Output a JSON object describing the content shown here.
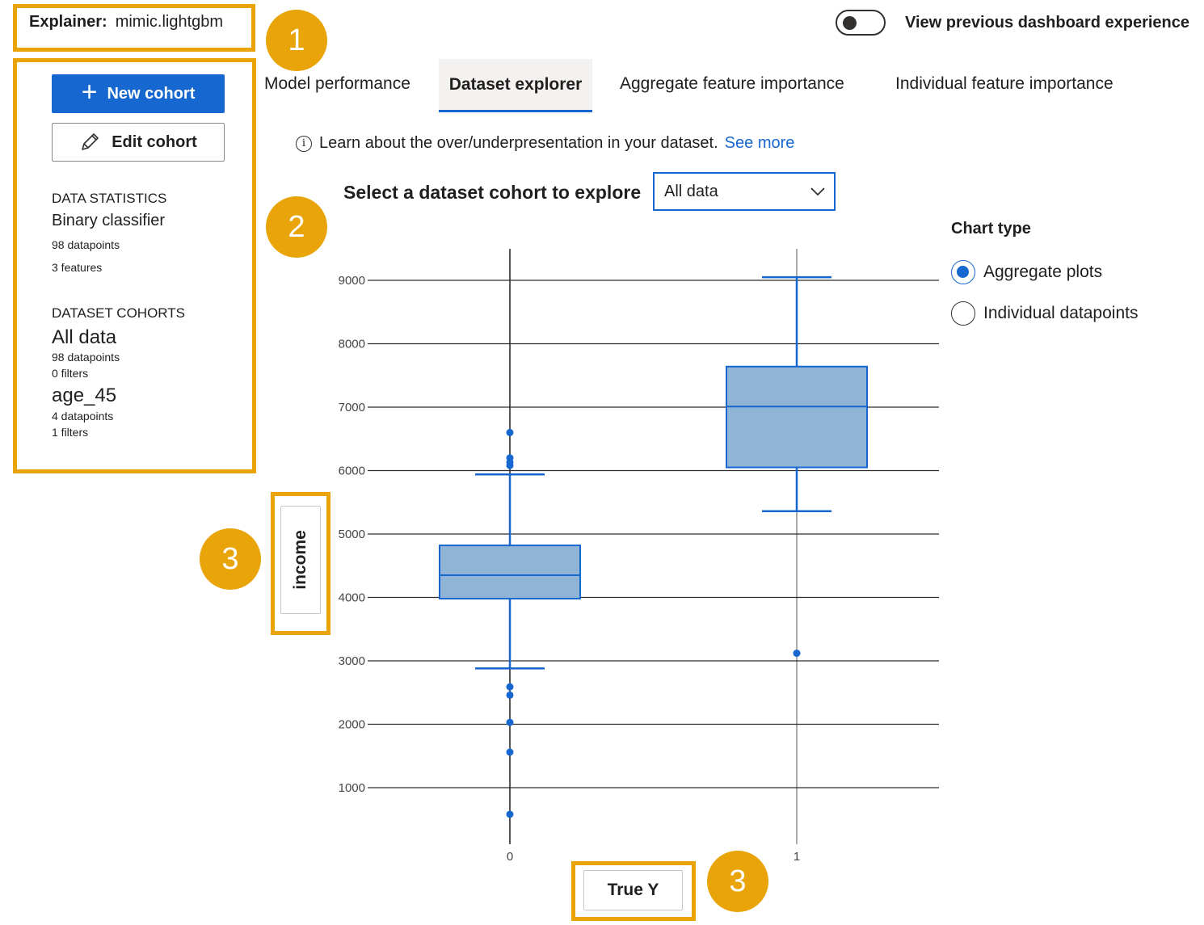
{
  "explainer": {
    "label": "Explainer:",
    "value": "mimic.lightgbm"
  },
  "toggle": {
    "label": "View previous dashboard experience",
    "on": false
  },
  "callouts": [
    "1",
    "2",
    "3",
    "3"
  ],
  "left_panel": {
    "new_cohort": "New cohort",
    "edit_cohort": "Edit cohort",
    "data_statistics": {
      "heading": "DATA STATISTICS",
      "type": "Binary classifier",
      "datapoints": "98 datapoints",
      "features": "3 features"
    },
    "dataset_cohorts": {
      "heading": "DATASET COHORTS",
      "items": [
        {
          "name": "All data",
          "datapoints": "98 datapoints",
          "filters": "0 filters"
        },
        {
          "name": "age_45",
          "datapoints": "4 datapoints",
          "filters": "1 filters"
        }
      ]
    }
  },
  "tabs": [
    {
      "label": "Model performance",
      "active": false
    },
    {
      "label": "Dataset explorer",
      "active": true
    },
    {
      "label": "Aggregate feature importance",
      "active": false
    },
    {
      "label": "Individual feature importance",
      "active": false
    }
  ],
  "info": {
    "text": "Learn about the over/underpresentation in your dataset.",
    "link": "See more",
    "icon": "info-icon"
  },
  "cohort_select": {
    "label": "Select a dataset cohort to explore",
    "value": "All data",
    "icon": "chevron-down-icon"
  },
  "chart_type": {
    "title": "Chart type",
    "options": [
      {
        "label": "Aggregate plots",
        "selected": true
      },
      {
        "label": "Individual datapoints",
        "selected": false
      }
    ]
  },
  "axis_buttons": {
    "y": "income",
    "x": "True Y"
  },
  "colors": {
    "accent": "#1667d0",
    "highlight": "#e8a409",
    "box_fill": "#8fb4d6"
  },
  "chart_data": {
    "type": "box",
    "categories": [
      "0",
      "1"
    ],
    "xlabel": "True Y",
    "ylabel": "income",
    "ylim": [
      0,
      9500
    ],
    "yticks": [
      1000,
      2000,
      3000,
      4000,
      5000,
      6000,
      7000,
      8000,
      9000
    ],
    "grid": true,
    "boxes": [
      {
        "category": "0",
        "whisker_low": 2880,
        "q1": 3980,
        "median": 4350,
        "q3": 4820,
        "whisker_high": 5940,
        "outliers": [
          6600,
          6200,
          6130,
          6080,
          2590,
          2460,
          2030,
          1560,
          580
        ]
      },
      {
        "category": "1",
        "whisker_low": 5360,
        "q1": 6050,
        "median": 7010,
        "q3": 7640,
        "whisker_high": 9050,
        "outliers": [
          3120
        ]
      }
    ]
  }
}
